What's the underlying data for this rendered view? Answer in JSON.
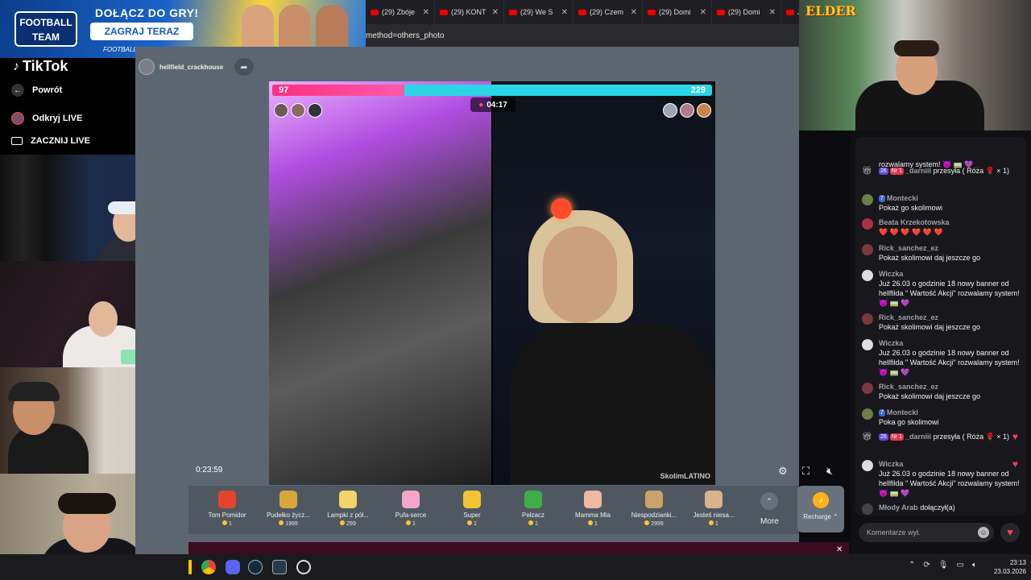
{
  "browser": {
    "tabs": [
      {
        "label": "(29) Zbóje"
      },
      {
        "label": "(29) KONT"
      },
      {
        "label": "(29) We S"
      },
      {
        "label": "(29) Czem"
      },
      {
        "label": "(29) Domi"
      },
      {
        "label": "(29) Domi"
      },
      {
        "label": "Je"
      }
    ],
    "url": "method=others_photo"
  },
  "ad": {
    "logo_line1": "FOOTBALL",
    "logo_line2": "TEAM",
    "title": "DOŁĄCZ DO GRY!",
    "button": "ZAGRAJ TERAZ",
    "url": "FOOTBALLTEAMGAME.COM"
  },
  "sidebar": {
    "logo": "TikTok",
    "back": "Powrót",
    "discover": "Odkryj LIVE",
    "go_live": "ZACZNIJ LIVE"
  },
  "stream": {
    "streamer": "hellfield_crackhouse",
    "pk_left_score": "97",
    "pk_right_score": "229",
    "pk_left_fraction": 0.3,
    "timer": "04:17",
    "watermark": "SkolimLATINO",
    "elapsed": "0:23:59"
  },
  "gifts": [
    {
      "name": "Tom Pomidor",
      "price": "1",
      "color": "#e2452b"
    },
    {
      "name": "Pudełko życz...",
      "price": "1999",
      "color": "#d9a63a"
    },
    {
      "name": "Lampki z pół...",
      "price": "299",
      "color": "#f2d46b"
    },
    {
      "name": "Pufa-serce",
      "price": "1",
      "color": "#f5a6c8"
    },
    {
      "name": "Super",
      "price": "1",
      "color": "#f4c531"
    },
    {
      "name": "Pełzacz",
      "price": "1",
      "color": "#3fae49"
    },
    {
      "name": "Mamma Mia",
      "price": "1",
      "color": "#f0b8a0"
    },
    {
      "name": "Niespodzianki...",
      "price": "2999",
      "color": "#c9a36b"
    },
    {
      "name": "Jesteś niesa...",
      "price": "1",
      "color": "#d9b38c"
    }
  ],
  "gift_more": "More",
  "recharge": "Recharge",
  "chat": {
    "messages": [
      {
        "name": "",
        "text": "rozwalamy system! 😈 🚃 💜",
        "avatar": "#555"
      },
      {
        "name": "_darniii",
        "badges": [
          "26",
          "Nr 1"
        ],
        "text": "przesyła ( Róża 🌹 × 1)",
        "avatar": "#444",
        "gift": true
      },
      {
        "name": "Montecki",
        "badges": [
          "7"
        ],
        "text": "Pokaż go skolimowi",
        "avatar": "#6b7f4a"
      },
      {
        "name": "Beata Krzekotowska",
        "text": "❤️ ❤️ ❤️ ❤️ ❤️ ❤️",
        "avatar": "#b03040"
      },
      {
        "name": "Rick_sanchez_ez",
        "text": "Pokaż skolimowi daj jeszcze go",
        "avatar": "#7a3a3a"
      },
      {
        "name": "Wiczka",
        "text": "Już 26.03 o godzinie 18 nowy banner od hellfilda \" Wartość Akcji\" rozwalamy system! 😈 🚃 💜",
        "avatar": "#ddd"
      },
      {
        "name": "Rick_sanchez_ez",
        "text": "Pokaż skolimowi daj jeszcze go",
        "avatar": "#7a3a3a"
      },
      {
        "name": "Wiczka",
        "text": "Już 26.03 o godzinie 18 nowy banner od hellfilda \" Wartość Akcji\" rozwalamy system! 😈 🚃 💜",
        "avatar": "#ddd"
      },
      {
        "name": "Rick_sanchez_ez",
        "text": "Pokaż skolimowi daj jeszcze go",
        "avatar": "#7a3a3a"
      },
      {
        "name": "Montecki",
        "badges": [
          "7"
        ],
        "text": "Poka go skolimowi",
        "avatar": "#6b7f4a"
      },
      {
        "name": "_darniii",
        "badges": [
          "26",
          "Nr 1"
        ],
        "text": "przesyła ( Róża 🌹 × 1)",
        "avatar": "#444",
        "gift": true
      },
      {
        "name": "Wiczka",
        "text": "Już 26.03 o godzinie 18 nowy banner od hellfilda \" Wartość Akcji\" rozwalamy system! 😈 🚃 💜",
        "avatar": "#ddd"
      },
      {
        "name": "Młody Arab",
        "text": "dołączył(a)",
        "avatar": "#444",
        "join": true
      }
    ],
    "input_placeholder": "Komentarze wył."
  },
  "overlay": {
    "elder_text": "ELDER"
  },
  "taskbar": {
    "time": "23:13",
    "date": "23.03.2026"
  }
}
